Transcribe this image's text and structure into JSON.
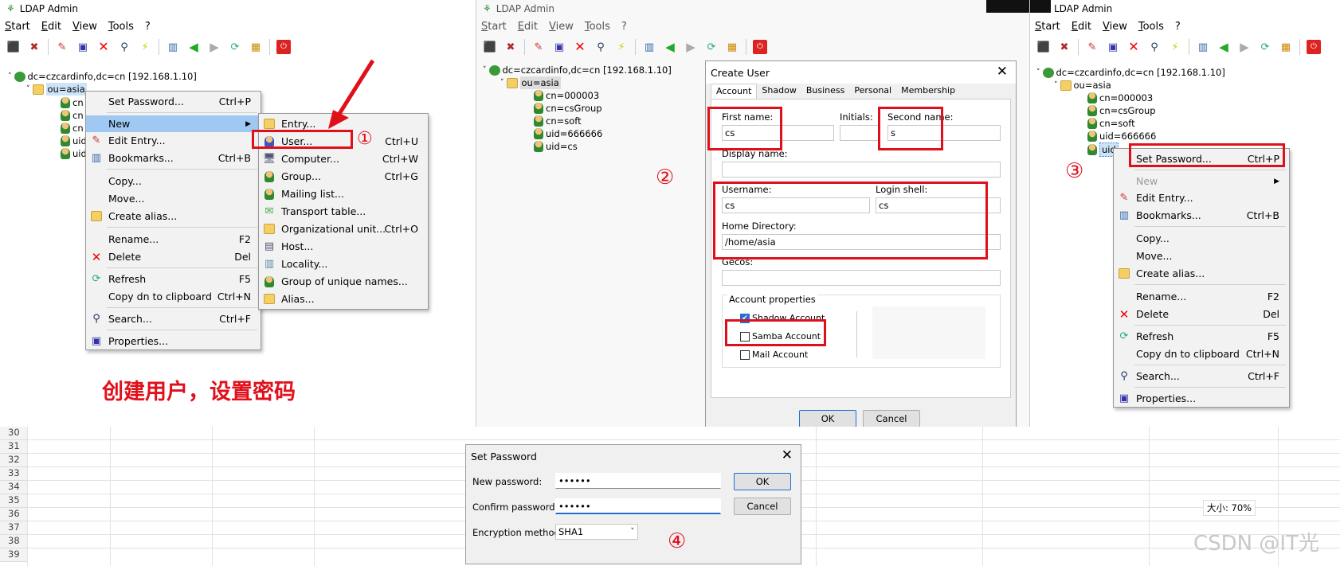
{
  "app_title": "LDAP Admin",
  "menus": [
    "Start",
    "Edit",
    "View",
    "Tools",
    "?"
  ],
  "tree": {
    "root": "dc=czcardinfo,dc=cn [192.168.1.10]",
    "ou": "ou=asia",
    "children": [
      "cn=000003",
      "cn=csGroup",
      "cn=soft",
      "uid=666666",
      "uid=cs"
    ],
    "truncated": [
      "cn",
      "cn",
      "cn",
      "uid",
      "uid"
    ],
    "selected_trunc": "uid"
  },
  "context_menu": {
    "items": [
      {
        "label": "Set Password...",
        "shortcut": "Ctrl+P"
      },
      {
        "label": "New",
        "shortcut": ""
      },
      {
        "label": "Edit Entry...",
        "shortcut": ""
      },
      {
        "label": "Bookmarks...",
        "shortcut": "Ctrl+B"
      },
      {
        "label": "Copy...",
        "shortcut": ""
      },
      {
        "label": "Move...",
        "shortcut": ""
      },
      {
        "label": "Create alias...",
        "shortcut": ""
      },
      {
        "label": "Rename...",
        "shortcut": "F2"
      },
      {
        "label": "Delete",
        "shortcut": "Del"
      },
      {
        "label": "Refresh",
        "shortcut": "F5"
      },
      {
        "label": "Copy dn to clipboard",
        "shortcut": "Ctrl+N"
      },
      {
        "label": "Search...",
        "shortcut": "Ctrl+F"
      },
      {
        "label": "Properties...",
        "shortcut": ""
      }
    ]
  },
  "submenu": {
    "items": [
      {
        "label": "Entry...",
        "shortcut": ""
      },
      {
        "label": "User...",
        "shortcut": "Ctrl+U"
      },
      {
        "label": "Computer...",
        "shortcut": "Ctrl+W"
      },
      {
        "label": "Group...",
        "shortcut": "Ctrl+G"
      },
      {
        "label": "Mailing list...",
        "shortcut": ""
      },
      {
        "label": "Transport table...",
        "shortcut": ""
      },
      {
        "label": "Organizational unit...",
        "shortcut": "Ctrl+O"
      },
      {
        "label": "Host...",
        "shortcut": ""
      },
      {
        "label": "Locality...",
        "shortcut": ""
      },
      {
        "label": "Group of unique names...",
        "shortcut": ""
      },
      {
        "label": "Alias...",
        "shortcut": ""
      }
    ]
  },
  "caption": "创建用户，设置密码",
  "steps": [
    "①",
    "②",
    "③",
    "④"
  ],
  "create_user": {
    "title": "Create User",
    "tabs": [
      "Account",
      "Shadow",
      "Business",
      "Personal",
      "Membership"
    ],
    "first_name_label": "First name:",
    "first_name": "cs",
    "initials_label": "Initials:",
    "initials": "",
    "second_name_label": "Second name:",
    "second_name": "s",
    "display_name_label": "Display name:",
    "display_name": "",
    "username_label": "Username:",
    "username": "cs",
    "login_shell_label": "Login shell:",
    "login_shell": "cs",
    "home_dir_label": "Home Directory:",
    "home_dir": "/home/asia",
    "gecos_label": "Gecos:",
    "gecos": "",
    "account_props_label": "Account properties",
    "checks": [
      {
        "label": "Shadow Account",
        "checked": true
      },
      {
        "label": "Samba Account",
        "checked": false
      },
      {
        "label": "Mail Account",
        "checked": false
      }
    ],
    "ok": "OK",
    "cancel": "Cancel"
  },
  "set_password": {
    "title": "Set Password",
    "new_label": "New password:",
    "new_value": "••••••",
    "confirm_label": "Confirm password:",
    "confirm_value": "••••••",
    "enc_label": "Encryption method:",
    "enc_value": "SHA1",
    "ok": "OK",
    "cancel": "Cancel"
  },
  "sheet": {
    "rows": [
      "30",
      "31",
      "32",
      "33",
      "34",
      "35",
      "36",
      "37",
      "38",
      "39"
    ],
    "zoom_text": "大小: 70%"
  },
  "watermark": "CSDN @IT光",
  "colors": {
    "annotation_red": "#e0101b",
    "highlight": "#9fc9f2"
  }
}
